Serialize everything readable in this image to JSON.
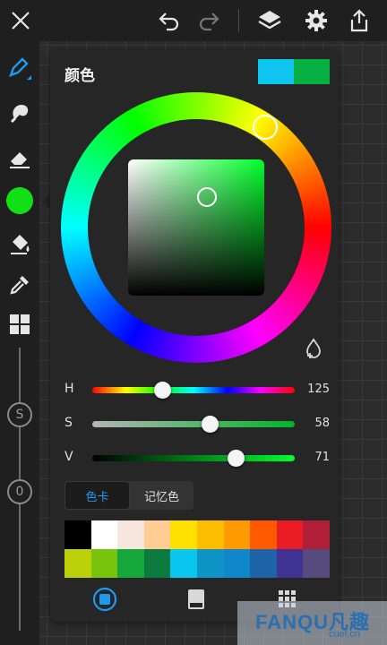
{
  "panel": {
    "title": "颜色"
  },
  "current_colors": {
    "primary": "#0fc6f1",
    "secondary": "#08b043"
  },
  "sliders": [
    {
      "label": "H",
      "value": "125",
      "fraction": 0.347,
      "track": "linear-gradient(to right,#ff0000,#ffff00,#00ff00,#00ffff,#0000ff,#ff00ff,#ff0000)"
    },
    {
      "label": "S",
      "value": "58",
      "fraction": 0.58,
      "track": "linear-gradient(to right,#b5b5b5,#00b52a)"
    },
    {
      "label": "V",
      "value": "71",
      "fraction": 0.71,
      "track": "linear-gradient(to right,#000000,#00ff30)"
    }
  ],
  "tabs": {
    "swatches": "色卡",
    "history": "记忆色"
  },
  "palette": [
    "#000000",
    "#ffffff",
    "#f6e6de",
    "#ffcc94",
    "#ffdf00",
    "#ffbd00",
    "#ff9a00",
    "#ff5a00",
    "#ea1c24",
    "#b01e37",
    "#bcd10a",
    "#78c40c",
    "#17a83c",
    "#0c7a3f",
    "#0ac6ef",
    "#0e94c7",
    "#1187cb",
    "#1c63a8",
    "#413393",
    "#574a7c"
  ],
  "accent_color": "#1e9af0",
  "watermark": {
    "brand": "FANQU凡趣",
    "domain": "cuel.cn"
  },
  "icons": {
    "close": "close-icon",
    "undo": "undo-icon",
    "redo": "redo-icon",
    "layers": "layers-icon",
    "settings": "gear-icon",
    "share": "share-icon",
    "pen": "pen-icon",
    "smudge": "smudge-icon",
    "eraser": "eraser-icon",
    "fill": "fill-bucket-icon",
    "eyedropper": "eyedropper-icon",
    "grid": "grid-icon",
    "add_drop": "add-color-drop-icon"
  },
  "tool_slots": {
    "size": "S",
    "opacity": "0"
  }
}
